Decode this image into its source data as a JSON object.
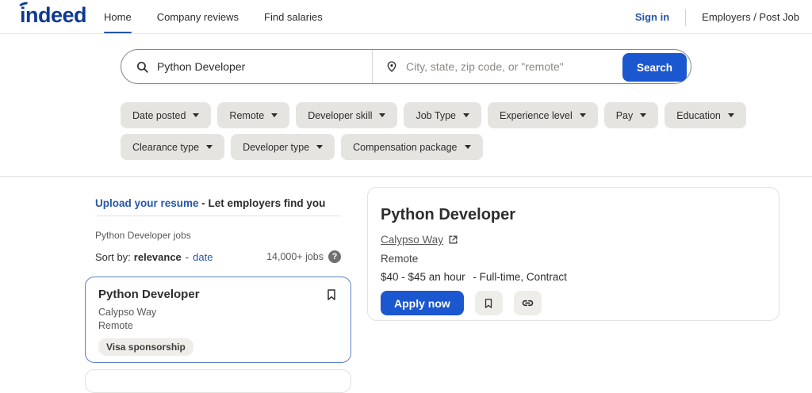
{
  "header": {
    "logo": "indeed",
    "nav": [
      {
        "label": "Home"
      },
      {
        "label": "Company reviews"
      },
      {
        "label": "Find salaries"
      }
    ],
    "sign_in": "Sign in",
    "employers": "Employers / Post Job"
  },
  "search": {
    "keyword_value": "Python Developer",
    "location_placeholder": "City, state, zip code, or \"remote\"",
    "button_label": "Search"
  },
  "filters": {
    "row1": [
      "Date posted",
      "Remote",
      "Developer skill",
      "Job Type",
      "Experience level",
      "Pay",
      "Education"
    ],
    "row2": [
      "Clearance type",
      "Developer type",
      "Compensation package"
    ]
  },
  "results": {
    "resume_link": "Upload your resume",
    "resume_rest": "- Let employers find you",
    "jobs_heading": "Python Developer jobs",
    "sort_label": "Sort by:",
    "sort_relevance": "relevance",
    "sort_dash": "-",
    "sort_date": "date",
    "job_count": "14,000+ jobs",
    "help_icon": "?",
    "job_card": {
      "title": "Python Developer",
      "company": "Calypso Way",
      "location": "Remote",
      "badge": "Visa sponsorship"
    }
  },
  "detail": {
    "title": "Python Developer",
    "company": "Calypso Way",
    "location": "Remote",
    "salary": "$40 - $45 an hour",
    "job_type": "- Full-time, Contract",
    "apply_label": "Apply now"
  },
  "colors": {
    "brand_navy": "#0d3a93",
    "link_blue": "#2557a7",
    "button_blue": "#1b57cf",
    "selected_card_border": "#5b82c6"
  }
}
